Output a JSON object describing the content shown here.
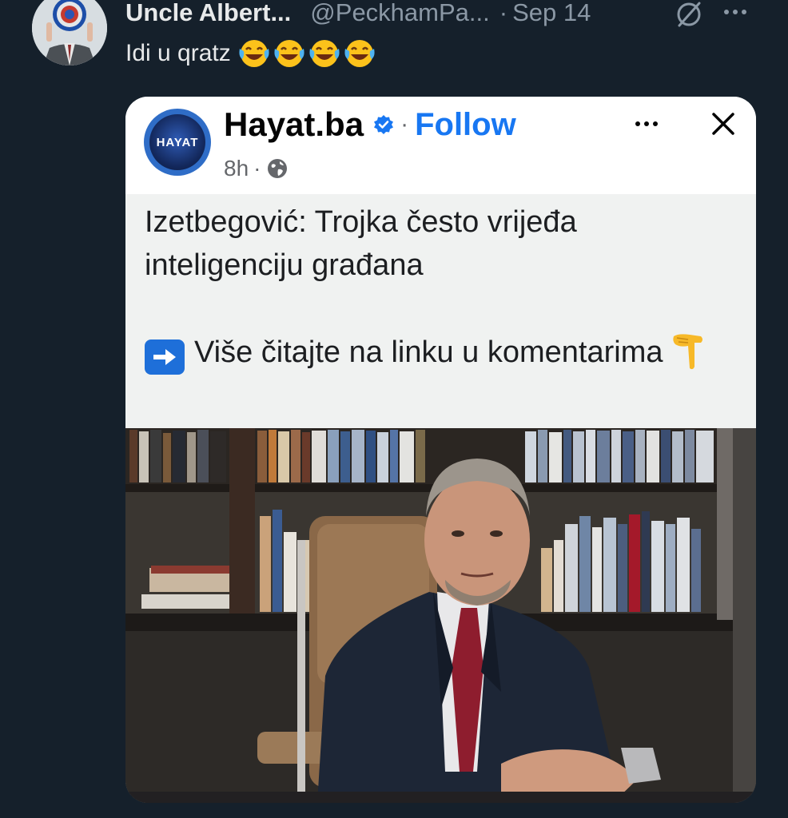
{
  "tweet": {
    "author_name": "Uncle Albert...",
    "author_handle": "@PeckhamPa...",
    "separator": "·",
    "date": "Sep 14",
    "text": "Idi u qratz",
    "emojis": [
      "face-with-tears-of-joy",
      "face-with-tears-of-joy",
      "face-with-tears-of-joy",
      "face-with-tears-of-joy"
    ]
  },
  "embedded_post": {
    "page_name": "Hayat.ba",
    "separator": "·",
    "follow_label": "Follow",
    "time": "8h",
    "meta_separator": "·",
    "logo_text": "HAYAT",
    "headline": "Izetbegović: Trojka često vrijeđa inteligenciju građana",
    "more_text": "Više čitajte na linku u komentarima",
    "icons": [
      "verified-badge",
      "globe",
      "more-dots",
      "close",
      "arrow-right-emoji",
      "pointing-down-emoji"
    ]
  },
  "colors": {
    "background": "#15202b",
    "primary_text": "#e7e9ea",
    "secondary_text": "#8b98a5",
    "facebook_blue": "#1877f2"
  }
}
